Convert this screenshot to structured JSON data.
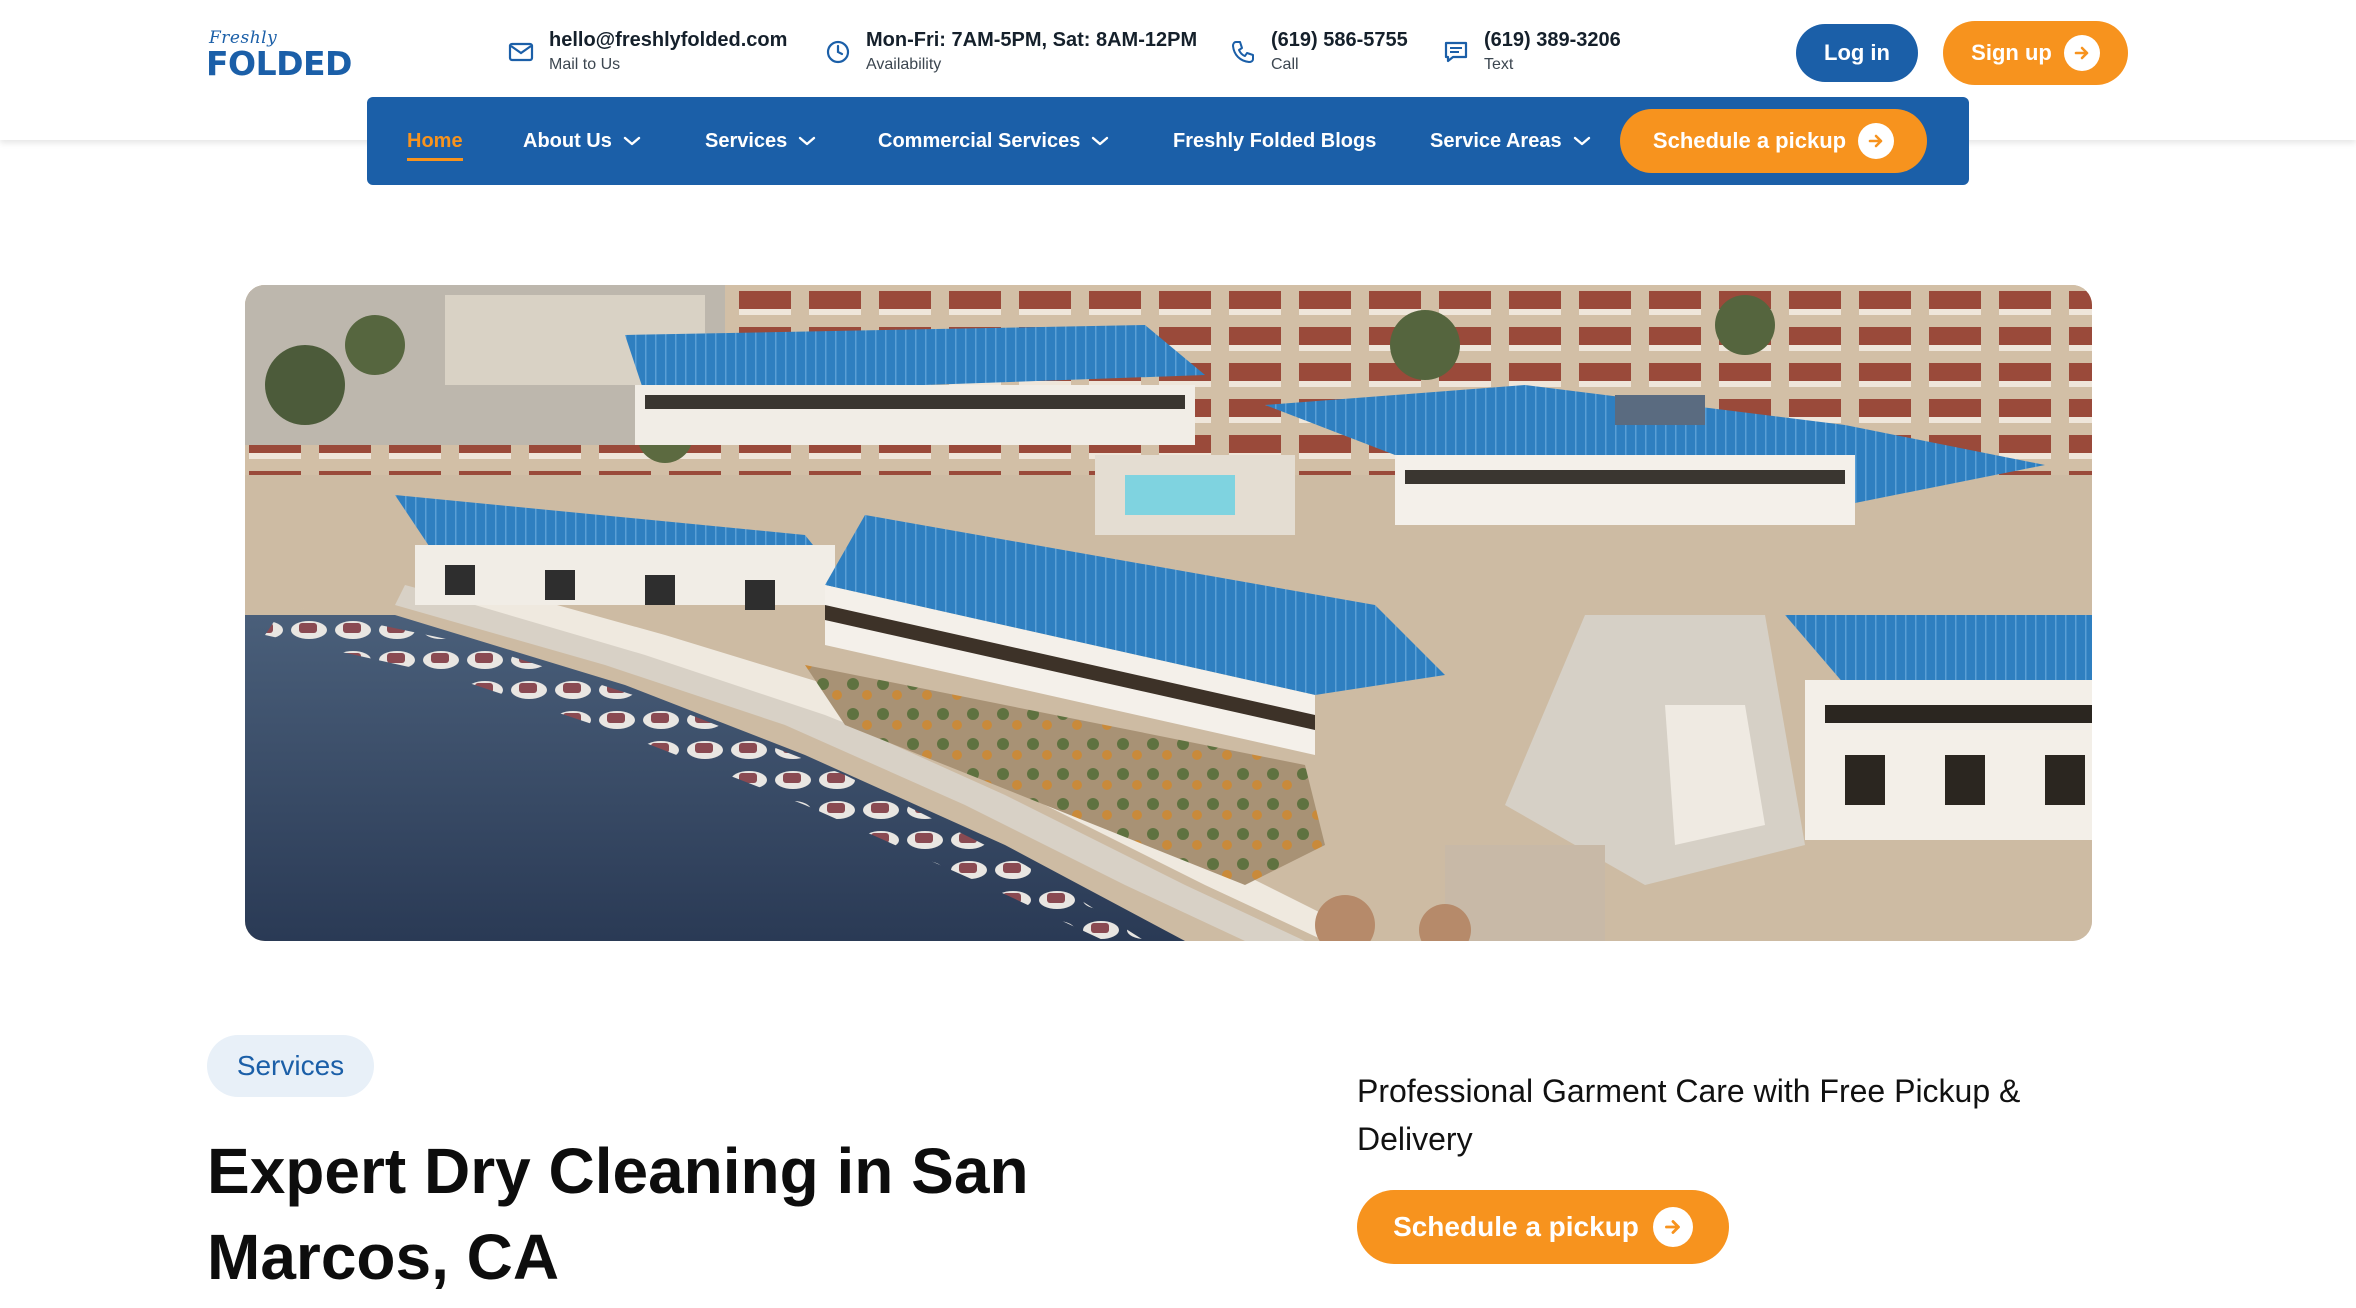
{
  "brand": {
    "logo_script": "Freshly",
    "logo_word": "FOLDED",
    "primary_color": "#1b5fa8",
    "accent_color": "#f7931e"
  },
  "contacts": [
    {
      "icon": "mail-icon",
      "main": "hello@freshlyfolded.com",
      "sub": "Mail to Us"
    },
    {
      "icon": "clock-icon",
      "main": "Mon-Fri: 7AM-5PM, Sat: 8AM-12PM",
      "sub": "Availability"
    },
    {
      "icon": "phone-icon",
      "main": "(619) 586-5755",
      "sub": "Call"
    },
    {
      "icon": "message-icon",
      "main": "(619) 389-3206",
      "sub": "Text"
    }
  ],
  "auth": {
    "login_label": "Log in",
    "signup_label": "Sign up"
  },
  "nav": {
    "items": [
      {
        "label": "Home",
        "active": true,
        "dropdown": false
      },
      {
        "label": "About Us",
        "active": false,
        "dropdown": true
      },
      {
        "label": "Services",
        "active": false,
        "dropdown": true
      },
      {
        "label": "Commercial Services",
        "active": false,
        "dropdown": true
      },
      {
        "label": "Freshly Folded Blogs",
        "active": false,
        "dropdown": false
      },
      {
        "label": "Service Areas",
        "active": false,
        "dropdown": true
      }
    ],
    "cta_label": "Schedule a pickup"
  },
  "hero": {
    "tag": "Services",
    "headline": "Expert Dry Cleaning in San Marcos, CA",
    "subheadline": "Professional Garment Care with Free Pickup & Delivery",
    "cta_label": "Schedule a pickup"
  }
}
